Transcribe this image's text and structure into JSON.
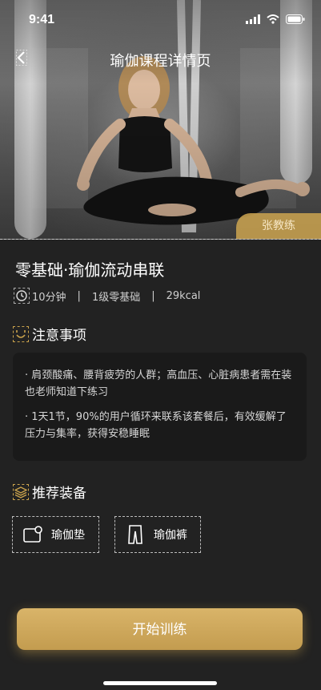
{
  "status_bar": {
    "time": "9:41"
  },
  "header": {
    "title": "瑜伽课程详情页"
  },
  "hero": {
    "coach_tag": "张教练"
  },
  "course": {
    "title": "零基础·瑜伽流动串联",
    "duration": "10分钟",
    "level": "1级零基础",
    "calories": "29kcal",
    "separator": "|"
  },
  "notes_section": {
    "title": "注意事项",
    "items": [
      "· 肩颈酸痛、腰背疲劳的人群；高血压、心脏病患者需在装也老师知道下练习",
      "· 1天1节，90%的用户循环来联系该套餐后，有效缓解了压力与集率，获得安稳睡眠"
    ]
  },
  "equipment_section": {
    "title": "推荐装备",
    "items": [
      {
        "label": "瑜伽垫",
        "icon": "yoga-mat-icon"
      },
      {
        "label": "瑜伽裤",
        "icon": "yoga-pants-icon"
      }
    ]
  },
  "actions": {
    "start_label": "开始训练"
  },
  "colors": {
    "accent": "#c9a24c",
    "background": "#222222",
    "card": "#1a1a1a"
  }
}
